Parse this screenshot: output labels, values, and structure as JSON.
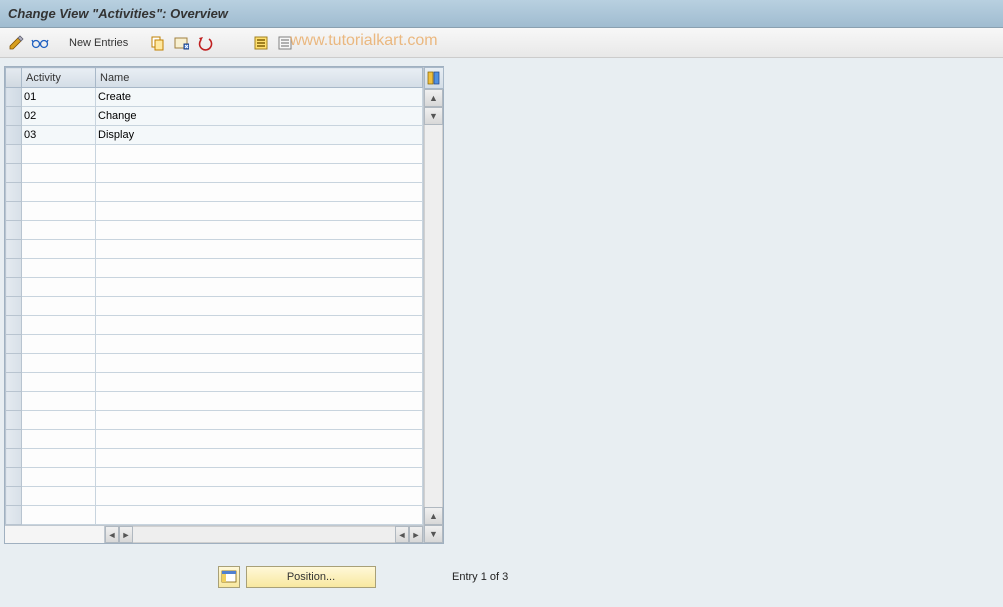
{
  "title": "Change View \"Activities\": Overview",
  "toolbar": {
    "new_entries_label": "New Entries"
  },
  "watermark": "www.tutorialkart.com",
  "table": {
    "columns": {
      "activity": "Activity",
      "name": "Name"
    },
    "rows": [
      {
        "activity": "01",
        "name": "Create"
      },
      {
        "activity": "02",
        "name": "Change"
      },
      {
        "activity": "03",
        "name": "Display"
      }
    ],
    "empty_rows": 20
  },
  "footer": {
    "position_label": "Position...",
    "entry_status": "Entry 1 of 3"
  }
}
